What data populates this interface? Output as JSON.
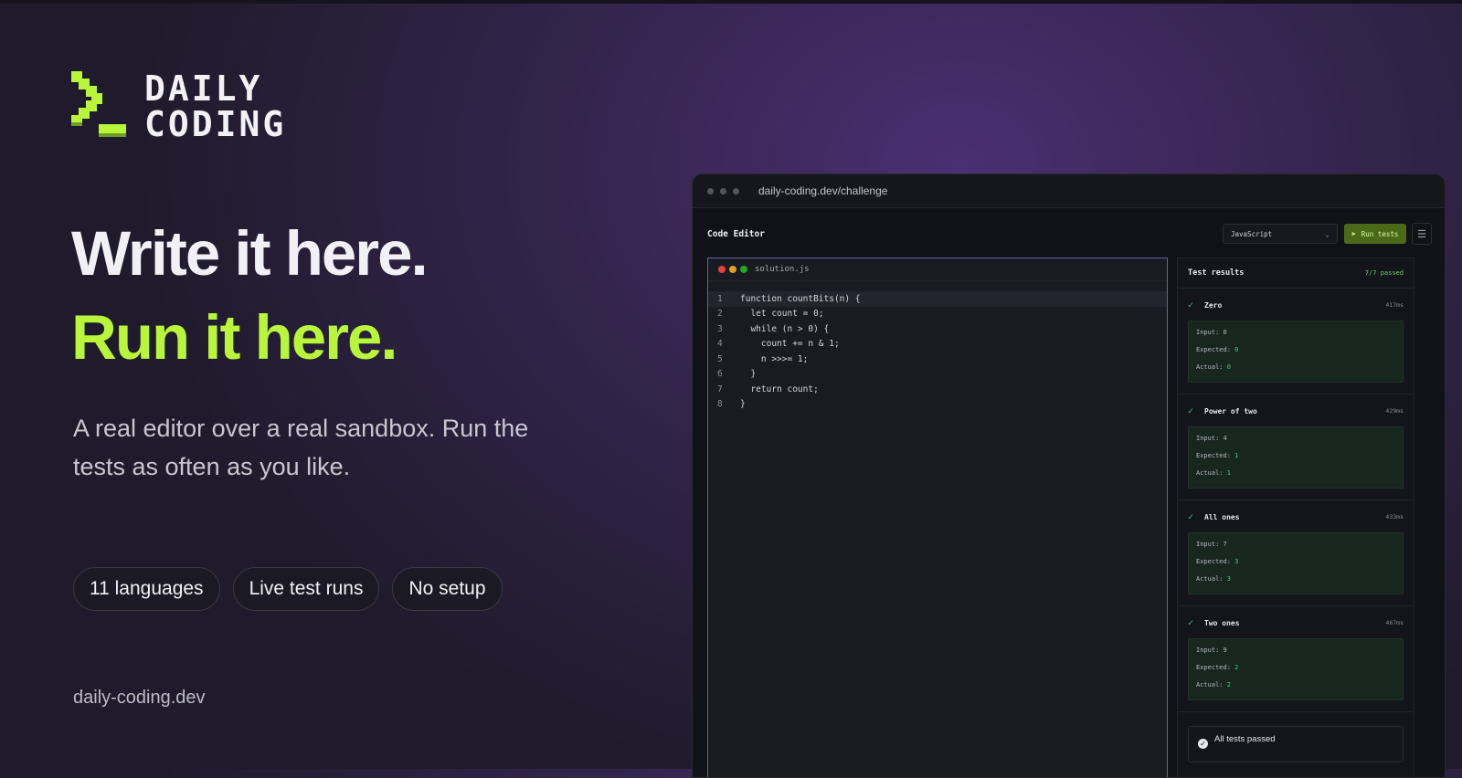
{
  "logo": {
    "line1": "DAILY",
    "line2": "CODING",
    "mark_color": "#b9f53a"
  },
  "hero": {
    "headline": "Write it here.",
    "headline_accent": "Run it here.",
    "subtext": "A real editor over a real sandbox. Run the tests as often as you like.",
    "accent_color": "#b9f53a"
  },
  "pills": [
    "11 languages",
    "Live test runs",
    "No setup"
  ],
  "footer": {
    "domain": "daily-coding.dev"
  },
  "browser": {
    "url": "daily-coding.dev/challenge",
    "app_title": "Code Editor",
    "language": "JavaScript",
    "run_label": "Run tests",
    "file_name": "solution.js",
    "code_lines": [
      "function countBits(n) {",
      "  let count = 0;",
      "  while (n > 0) {",
      "    count += n & 1;",
      "    n >>>= 1;",
      "  }",
      "  return count;",
      "}"
    ],
    "results": {
      "title": "Test results",
      "summary": "7/7 passed",
      "tests": [
        {
          "name": "Zero",
          "time": "417ms",
          "input": "0",
          "expected": "0",
          "actual": "0"
        },
        {
          "name": "Power of two",
          "time": "429ms",
          "input": "4",
          "expected": "1",
          "actual": "1"
        },
        {
          "name": "All ones",
          "time": "433ms",
          "input": "7",
          "expected": "3",
          "actual": "3"
        },
        {
          "name": "Two ones",
          "time": "467ms",
          "input": "9",
          "expected": "2",
          "actual": "2"
        }
      ],
      "labels": {
        "input": "Input:",
        "expected": "Expected:",
        "actual": "Actual:"
      },
      "final_message": "All tests passed"
    }
  }
}
